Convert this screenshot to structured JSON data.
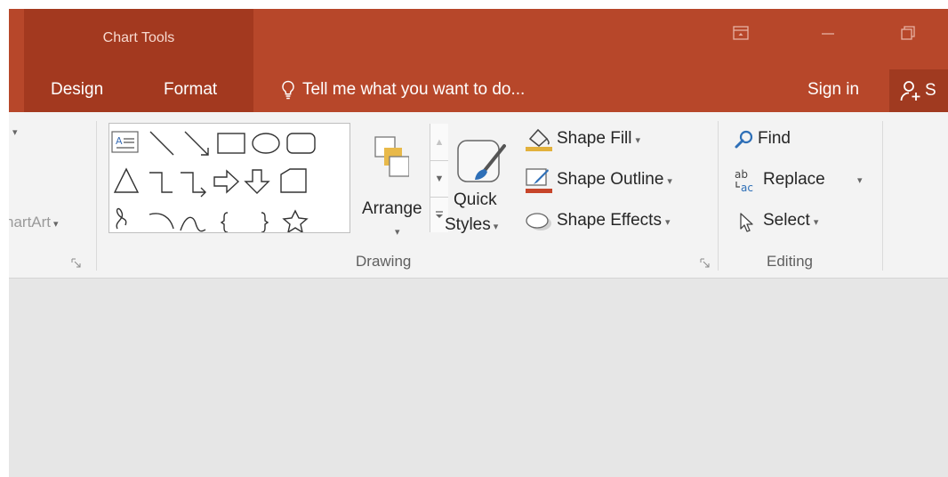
{
  "window": {
    "context_group_title": "Chart Tools",
    "tabs": [
      "Design",
      "Format"
    ],
    "tell_me": "Tell me what you want to do...",
    "sign_in": "Sign in",
    "share_label": "S"
  },
  "ribbon": {
    "left_group": {
      "partial_label": "hartArt",
      "dropdown": "▾"
    },
    "drawing": {
      "label": "Drawing",
      "arrange_label": "Arrange",
      "quick_styles_line1": "Quick",
      "quick_styles_line2": "Styles",
      "shape_fill": "Shape Fill",
      "shape_outline": "Shape Outline",
      "shape_effects": "Shape Effects"
    },
    "editing": {
      "label": "Editing",
      "find": "Find",
      "replace": "Replace",
      "select": "Select"
    }
  },
  "colors": {
    "title_bar": "#b7472a",
    "context_group": "#a3391f",
    "ribbon": "#f3f3f3",
    "workspace": "#e6e6e6"
  },
  "icons": [
    "text-box-icon",
    "line-icon",
    "arrow-line-icon",
    "rectangle-icon",
    "oval-icon",
    "rounded-rectangle-icon",
    "triangle-icon",
    "elbow-connector-icon",
    "elbow-arrow-connector-icon",
    "right-arrow-icon",
    "down-arrow-icon",
    "flowchart-icon",
    "freeform-icon",
    "arc-icon",
    "curve-icon",
    "left-brace-icon",
    "right-brace-icon",
    "star-icon",
    "arrange-icon",
    "quick-styles-icon",
    "paint-bucket-icon",
    "pen-outline-icon",
    "shape-effects-icon",
    "find-icon",
    "replace-icon",
    "select-cursor-icon",
    "lightbulb-icon",
    "person-add-icon"
  ]
}
